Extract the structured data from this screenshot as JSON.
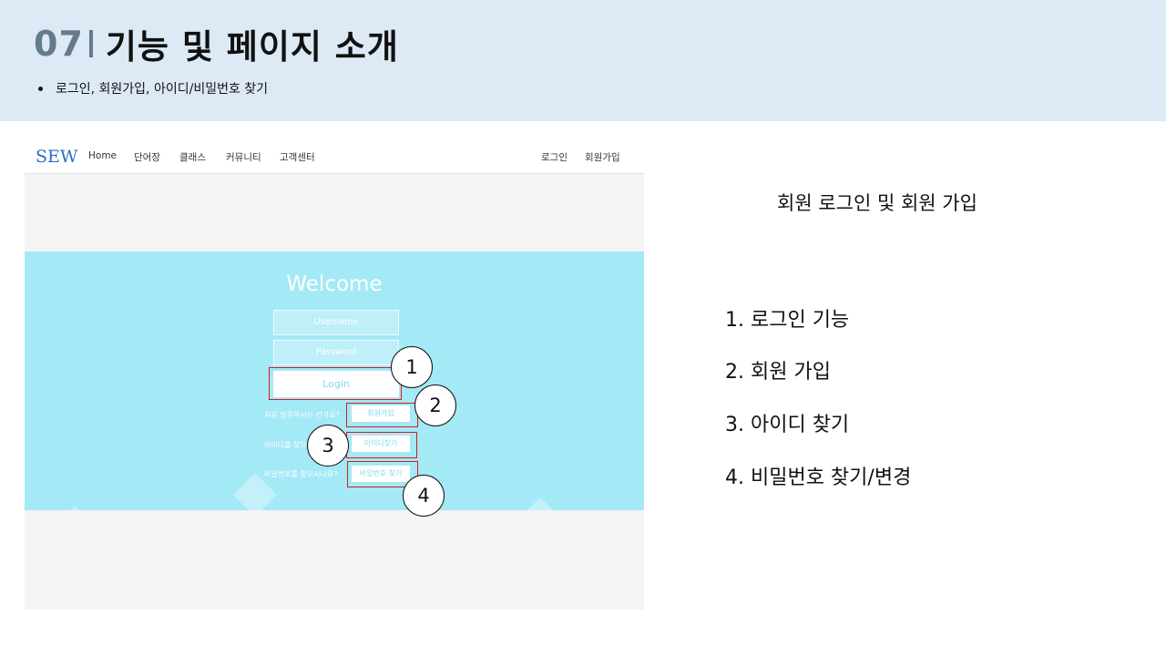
{
  "slide": {
    "number": "07",
    "title": "기능 및 페이지 소개",
    "bullet": "로그인, 회원가입, 아이디/비밀번호 찾기"
  },
  "site": {
    "brand": "SEW",
    "nav": [
      "Home",
      "단어장",
      "클래스",
      "커뮤니티",
      "고객센터"
    ],
    "nav_right": [
      "로그인",
      "회원가입"
    ],
    "welcome": "Welcome",
    "username_placeholder": "Username",
    "password_placeholder": "Password",
    "login_label": "Login",
    "rows": [
      {
        "question": "처음 방문하시는 건가요?",
        "button": "회원가입"
      },
      {
        "question": "아이디를 찾으시나요?",
        "button": "아이디찾기"
      },
      {
        "question": "비밀번호를 찾으시나요?",
        "button": "비밀번호 찾기"
      }
    ],
    "callouts": [
      "1",
      "2",
      "3",
      "4"
    ],
    "colors": {
      "hero": "#a4e9f6",
      "brand": "#2a6fc9",
      "highlight": "#d11d1d"
    }
  },
  "panel": {
    "title": "회원 로그인 및 회원 가입",
    "features": [
      "1. 로그인 기능",
      "2. 회원 가입",
      "3. 아이디 찾기",
      "4. 비밀번호 찾기/변경"
    ]
  }
}
